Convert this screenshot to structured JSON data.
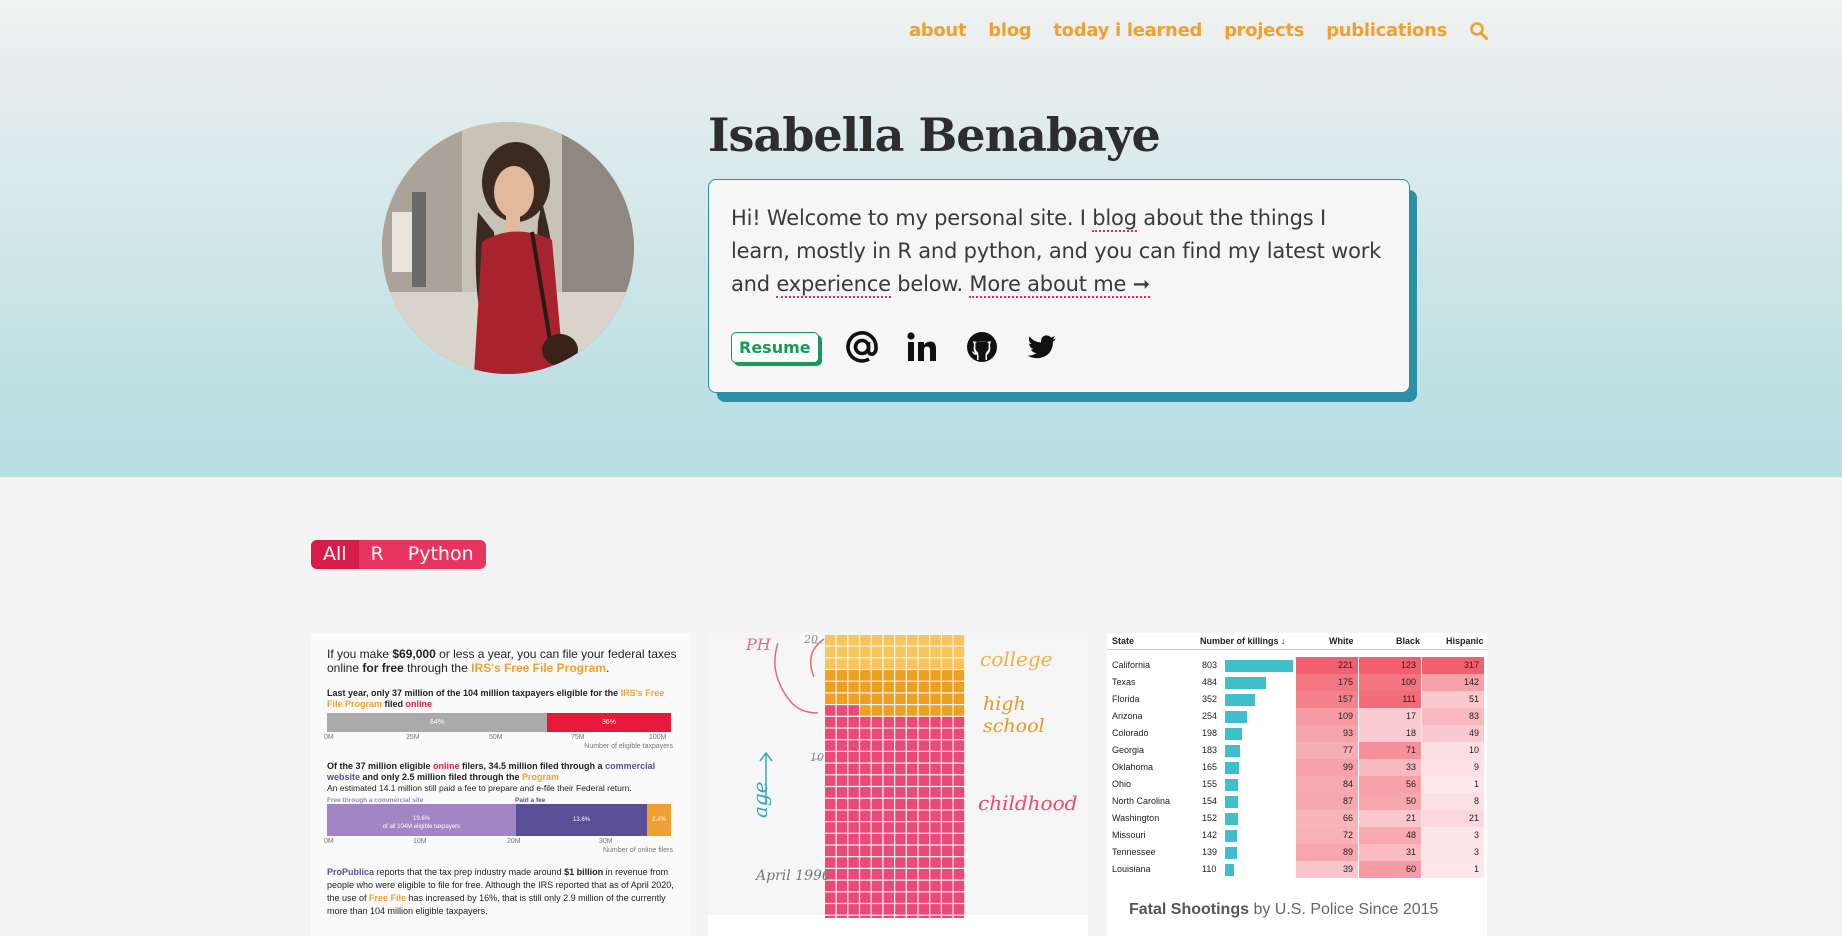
{
  "nav": {
    "items": [
      "about",
      "blog",
      "today i learned",
      "projects",
      "publications"
    ],
    "search_icon": "search-icon"
  },
  "colors": {
    "nav": "#f0a030",
    "intro_border": "#2b8fa6",
    "resume": "#1a9a5a",
    "filter": "#e8355f",
    "underline": "#d83050"
  },
  "profile": {
    "name": "Isabella Benabaye",
    "intro_part1": "Hi! Welcome to my personal site. I ",
    "intro_blog_link": "blog",
    "intro_part2": " about the things I learn, mostly in R and python, and you can find my latest work and ",
    "intro_experience_link": "experience",
    "intro_part3": " below. ",
    "intro_more_link": "More about me ➞",
    "resume_label": "Resume",
    "social_icons": [
      "email-icon",
      "linkedin-icon",
      "github-icon",
      "twitter-icon"
    ]
  },
  "filters": {
    "items": [
      "All",
      "R",
      "Python"
    ],
    "active": "All"
  },
  "card1": {
    "intro_a": "If you make ",
    "intro_amount": "$69,000",
    "intro_b": " or less a year, you can file your federal taxes online ",
    "intro_free": "for free",
    "intro_c": " through the ",
    "intro_program": "IRS's Free File Program",
    "intro_d": ".",
    "chart1_title_a": "Last year, only 37 million of the 104 million taxpayers eligible for the ",
    "chart1_title_program": "IRS's Free File Program",
    "chart1_title_b": " filed ",
    "chart1_title_online": "online",
    "chart1_bar_left": "64%",
    "chart1_bar_right": "36%",
    "chart1_ticks": [
      "0M",
      "25M",
      "50M",
      "75M",
      "100M"
    ],
    "chart1_axis": "Number of eligible taxpayers",
    "chart2_title_a": "Of the 37 million eligible ",
    "chart2_title_online": "online",
    "chart2_title_b": " filers, 34.5 million filed through a ",
    "chart2_title_commercial": "commercial website",
    "chart2_title_c": " and only 2.5 million filed through the ",
    "chart2_title_program": "Program",
    "chart2_sub": "An estimated 14.1 million still paid a fee to prepare and e-file  their Federal return.",
    "chart2_label_free": "Free through a commercial site",
    "chart2_label_paid": "Paid a fee",
    "chart2_bar_a": "19.6%",
    "chart2_bar_a_sub": "of all 104M eligible taxpayers",
    "chart2_bar_b": "13.6%",
    "chart2_bar_c": "2.4%",
    "chart2_ticks": [
      "0M",
      "10M",
      "20M",
      "30M"
    ],
    "chart2_axis": "Number of online filers",
    "footer_org": "ProPublica",
    "footer_a": " reports that the tax prep industry made around ",
    "footer_amount": "$1 billion",
    "footer_b": " in revenue from people who were eligible to file for free. Although the IRS reported that as of April 2020, the use of ",
    "footer_freefile": "Free File",
    "footer_c": " has increased by 16%, that is still only 2.9 million of the currently more than 104 million eligible taxpayers."
  },
  "card2": {
    "label_ph": "PH",
    "label_20": "20",
    "label_10": "10",
    "label_age": "age",
    "label_date": "April 1996",
    "label_college": "college",
    "label_highschool": "high school",
    "label_childhood": "childhood"
  },
  "card3": {
    "headers": [
      "State",
      "Number of killings ↓",
      "White",
      "Black",
      "Hispanic"
    ],
    "rows": [
      {
        "state": "California",
        "total": "803",
        "white": "221",
        "black": "123",
        "hispanic": "317"
      },
      {
        "state": "Texas",
        "total": "484",
        "white": "175",
        "black": "100",
        "hispanic": "142"
      },
      {
        "state": "Florida",
        "total": "352",
        "white": "157",
        "black": "111",
        "hispanic": "51"
      },
      {
        "state": "Arizona",
        "total": "254",
        "white": "109",
        "black": "17",
        "hispanic": "83"
      },
      {
        "state": "Colorado",
        "total": "198",
        "white": "93",
        "black": "18",
        "hispanic": "49"
      },
      {
        "state": "Georgia",
        "total": "183",
        "white": "77",
        "black": "71",
        "hispanic": "10"
      },
      {
        "state": "Oklahoma",
        "total": "165",
        "white": "99",
        "black": "33",
        "hispanic": "9"
      },
      {
        "state": "Ohio",
        "total": "155",
        "white": "84",
        "black": "56",
        "hispanic": "1"
      },
      {
        "state": "North Carolina",
        "total": "154",
        "white": "87",
        "black": "50",
        "hispanic": "8"
      },
      {
        "state": "Washington",
        "total": "152",
        "white": "66",
        "black": "21",
        "hispanic": "21"
      },
      {
        "state": "Missouri",
        "total": "142",
        "white": "72",
        "black": "48",
        "hispanic": "3"
      },
      {
        "state": "Tennessee",
        "total": "139",
        "white": "89",
        "black": "31",
        "hispanic": "3"
      },
      {
        "state": "Louisiana",
        "total": "110",
        "white": "39",
        "black": "60",
        "hispanic": "1"
      }
    ],
    "title_bold": "Fatal Shootings",
    "title_rest": " by U.S. Police Since 2015"
  }
}
